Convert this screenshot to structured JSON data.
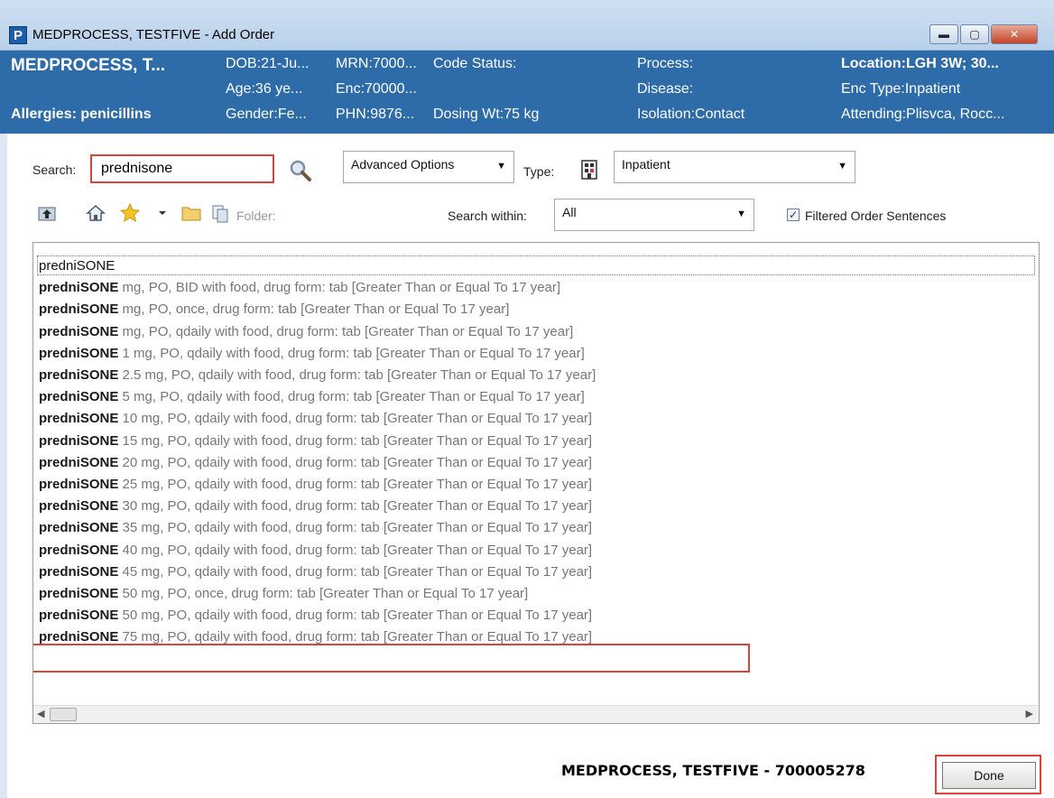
{
  "window": {
    "app_icon_letter": "P",
    "title": "MEDPROCESS, TESTFIVE - Add Order",
    "min_glyph": "▬",
    "max_glyph": "▢",
    "close_glyph": "✕"
  },
  "banner": {
    "name": "MEDPROCESS, T...",
    "allergies": "Allergies: penicillins",
    "dob": "DOB:21-Ju...",
    "age": "Age:36 ye...",
    "gender": "Gender:Fe...",
    "mrn": "MRN:7000...",
    "enc": "Enc:70000...",
    "phn": "PHN:9876...",
    "code_status": "Code Status:",
    "dosing_wt": "Dosing Wt:75 kg",
    "process": "Process:",
    "disease": "Disease:",
    "isolation": "Isolation:Contact",
    "location": "Location:LGH 3W; 30...",
    "enc_type": "Enc Type:Inpatient",
    "attending": "Attending:Plisvca, Rocc..."
  },
  "controls": {
    "search_label": "Search:",
    "search_value": "prednisone",
    "advanced_options": "Advanced Options",
    "type_label": "Type:",
    "type_value": "Inpatient",
    "folder_label": "Folder:",
    "search_within_label": "Search within:",
    "search_within_value": "All",
    "filtered_label": "Filtered Order Sentences",
    "filtered_checked": true,
    "checkbox_glyph": "✓",
    "dropdown_arrow": "▼"
  },
  "results": [
    {
      "drug": "predniSONE",
      "sentence": ""
    },
    {
      "drug": "predniSONE",
      "sentence": "mg, PO, BID with food, drug form: tab [Greater Than or Equal To 17 year]"
    },
    {
      "drug": "predniSONE",
      "sentence": "mg, PO, once, drug form: tab [Greater Than or Equal To 17 year]"
    },
    {
      "drug": "predniSONE",
      "sentence": "mg, PO, qdaily with food, drug form: tab [Greater Than or Equal To 17 year]"
    },
    {
      "drug": "predniSONE",
      "sentence": "1 mg, PO, qdaily with food, drug form: tab [Greater Than or Equal To 17 year]"
    },
    {
      "drug": "predniSONE",
      "sentence": "2.5 mg, PO, qdaily with food, drug form: tab [Greater Than or Equal To 17 year]"
    },
    {
      "drug": "predniSONE",
      "sentence": "5 mg, PO, qdaily with food, drug form: tab [Greater Than or Equal To 17 year]"
    },
    {
      "drug": "predniSONE",
      "sentence": "10 mg, PO, qdaily with food, drug form: tab [Greater Than or Equal To 17 year]"
    },
    {
      "drug": "predniSONE",
      "sentence": "15 mg, PO, qdaily with food, drug form: tab [Greater Than or Equal To 17 year]"
    },
    {
      "drug": "predniSONE",
      "sentence": "20 mg, PO, qdaily with food, drug form: tab [Greater Than or Equal To 17 year]"
    },
    {
      "drug": "predniSONE",
      "sentence": "25 mg, PO, qdaily with food, drug form: tab [Greater Than or Equal To 17 year]"
    },
    {
      "drug": "predniSONE",
      "sentence": "30 mg, PO, qdaily with food, drug form: tab [Greater Than or Equal To 17 year]"
    },
    {
      "drug": "predniSONE",
      "sentence": "35 mg, PO, qdaily with food, drug form: tab [Greater Than or Equal To 17 year]"
    },
    {
      "drug": "predniSONE",
      "sentence": "40 mg, PO, qdaily with food, drug form: tab [Greater Than or Equal To 17 year]"
    },
    {
      "drug": "predniSONE",
      "sentence": "45 mg, PO, qdaily with food, drug form: tab [Greater Than or Equal To 17 year]"
    },
    {
      "drug": "predniSONE",
      "sentence": "50 mg, PO, once, drug form: tab [Greater Than or Equal To 17 year]"
    },
    {
      "drug": "predniSONE",
      "sentence": "50 mg, PO, qdaily with food, drug form: tab [Greater Than or Equal To 17 year]"
    },
    {
      "drug": "predniSONE",
      "sentence": "75 mg, PO, qdaily with food, drug form: tab [Greater Than or Equal To 17 year]"
    }
  ],
  "scrollbar": {
    "left_glyph": "◀",
    "right_glyph": "▶"
  },
  "footer": {
    "patient": "MEDPROCESS, TESTFIVE - 700005278",
    "done": "Done"
  },
  "icons": [
    "app-icon",
    "minimize-icon",
    "maximize-icon",
    "close-icon",
    "search-icon",
    "chevron-down-icon",
    "inpatient-type-icon",
    "up-folder-icon",
    "home-icon",
    "favorites-star-icon",
    "folder-icon",
    "copy-icon"
  ],
  "colors": {
    "banner_bg": "#2d6ba9",
    "highlight_border": "#d9443a",
    "sentence_text": "#777777"
  }
}
